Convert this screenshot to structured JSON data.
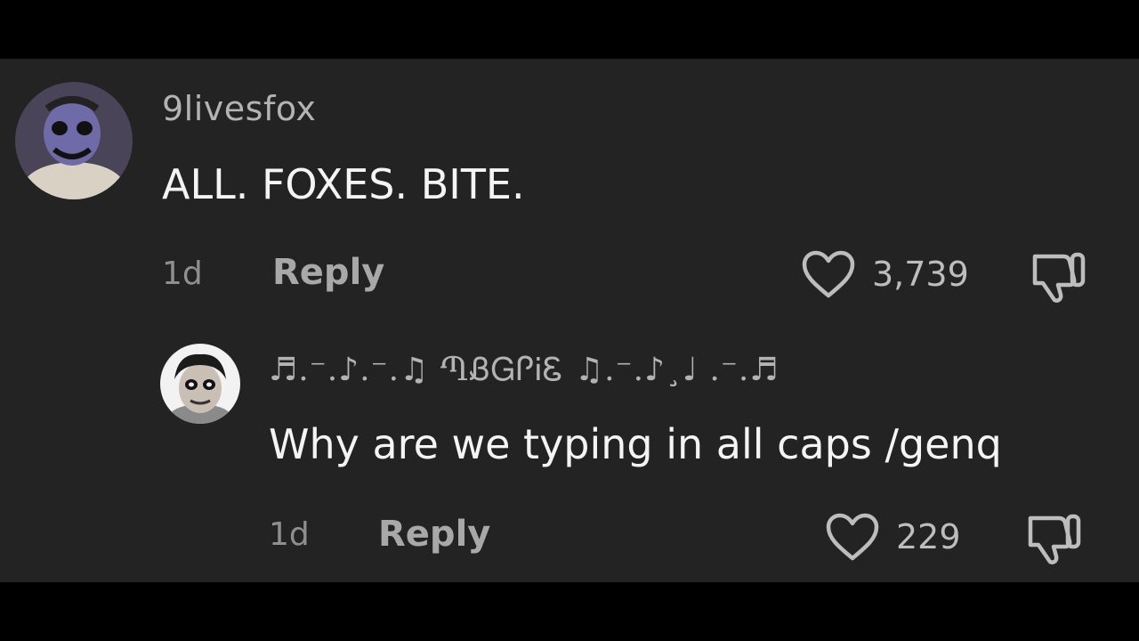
{
  "comments": [
    {
      "username": "9livesfox",
      "text": "ALL. FOXES. BITE.",
      "time": "1d",
      "reply_label": "Reply",
      "likes": "3,739"
    },
    {
      "username": "♬.⁻.♪.⁻.♫ ՊᏰᏀᎵᎥᏋ ♫.⁻.♪¸♩ .⁻.♬",
      "text": "Why are we typing in all caps /genq",
      "time": "1d",
      "reply_label": "Reply",
      "likes": "229"
    }
  ],
  "colors": {
    "background": "#232323",
    "letterbox": "#000000",
    "text_primary": "#f4f4f4",
    "text_secondary": "#8f8f8f"
  },
  "icons": {
    "like": "heart-outline-icon",
    "dislike": "thumbs-down-icon"
  }
}
